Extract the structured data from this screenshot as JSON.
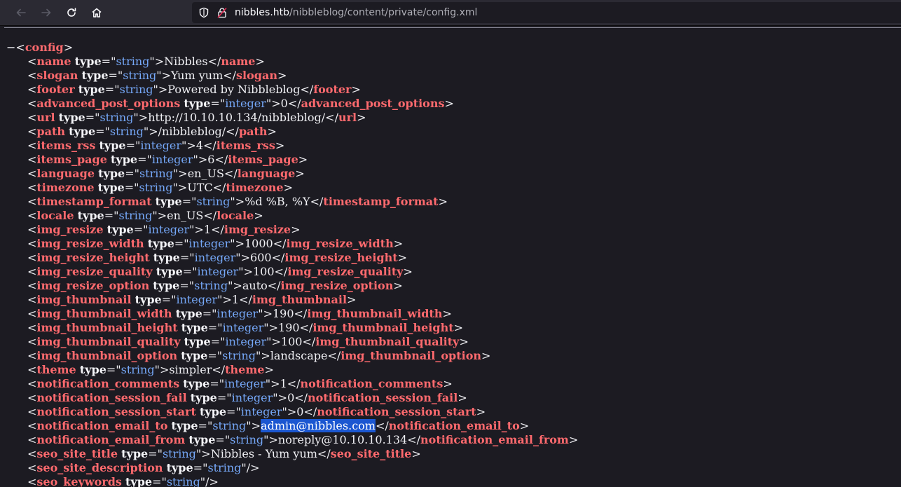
{
  "browser": {
    "url_host": "nibbles.htb",
    "url_path": "/nibbleblog/content/private/config.xml"
  },
  "xml": {
    "root_tag": "config",
    "collapse_glyph": "−",
    "rows": [
      {
        "tag": "name",
        "type": "string",
        "value": "Nibbles",
        "close": true
      },
      {
        "tag": "slogan",
        "type": "string",
        "value": "Yum yum",
        "close": true
      },
      {
        "tag": "footer",
        "type": "string",
        "value": "Powered by Nibbleblog",
        "close": true
      },
      {
        "tag": "advanced_post_options",
        "type": "integer",
        "value": "0",
        "close": true
      },
      {
        "tag": "url",
        "type": "string",
        "value": "http://10.10.10.134/nibbleblog/",
        "close": true
      },
      {
        "tag": "path",
        "type": "string",
        "value": "/nibbleblog/",
        "close": true
      },
      {
        "tag": "items_rss",
        "type": "integer",
        "value": "4",
        "close": true
      },
      {
        "tag": "items_page",
        "type": "integer",
        "value": "6",
        "close": true
      },
      {
        "tag": "language",
        "type": "string",
        "value": "en_US",
        "close": true
      },
      {
        "tag": "timezone",
        "type": "string",
        "value": "UTC",
        "close": true
      },
      {
        "tag": "timestamp_format",
        "type": "string",
        "value": "%d %B, %Y",
        "close": true
      },
      {
        "tag": "locale",
        "type": "string",
        "value": "en_US",
        "close": true
      },
      {
        "tag": "img_resize",
        "type": "integer",
        "value": "1",
        "close": true
      },
      {
        "tag": "img_resize_width",
        "type": "integer",
        "value": "1000",
        "close": true
      },
      {
        "tag": "img_resize_height",
        "type": "integer",
        "value": "600",
        "close": true
      },
      {
        "tag": "img_resize_quality",
        "type": "integer",
        "value": "100",
        "close": true
      },
      {
        "tag": "img_resize_option",
        "type": "string",
        "value": "auto",
        "close": true
      },
      {
        "tag": "img_thumbnail",
        "type": "integer",
        "value": "1",
        "close": true
      },
      {
        "tag": "img_thumbnail_width",
        "type": "integer",
        "value": "190",
        "close": true
      },
      {
        "tag": "img_thumbnail_height",
        "type": "integer",
        "value": "190",
        "close": true
      },
      {
        "tag": "img_thumbnail_quality",
        "type": "integer",
        "value": "100",
        "close": true
      },
      {
        "tag": "img_thumbnail_option",
        "type": "string",
        "value": "landscape",
        "close": true
      },
      {
        "tag": "theme",
        "type": "string",
        "value": "simpler",
        "close": true
      },
      {
        "tag": "notification_comments",
        "type": "integer",
        "value": "1",
        "close": true
      },
      {
        "tag": "notification_session_fail",
        "type": "integer",
        "value": "0",
        "close": true
      },
      {
        "tag": "notification_session_start",
        "type": "integer",
        "value": "0",
        "close": true
      },
      {
        "tag": "notification_email_to",
        "type": "string",
        "value": "admin@nibbles.com",
        "close": true,
        "selected": true
      },
      {
        "tag": "notification_email_from",
        "type": "string",
        "value": "noreply@10.10.10.134",
        "close": true
      },
      {
        "tag": "seo_site_title",
        "type": "string",
        "value": "Nibbles - Yum yum",
        "close": true
      },
      {
        "tag": "seo_site_description",
        "type": "string",
        "value": "",
        "close": false
      },
      {
        "tag": "seo_keywords",
        "type": "string",
        "value": "",
        "close": false
      }
    ]
  }
}
